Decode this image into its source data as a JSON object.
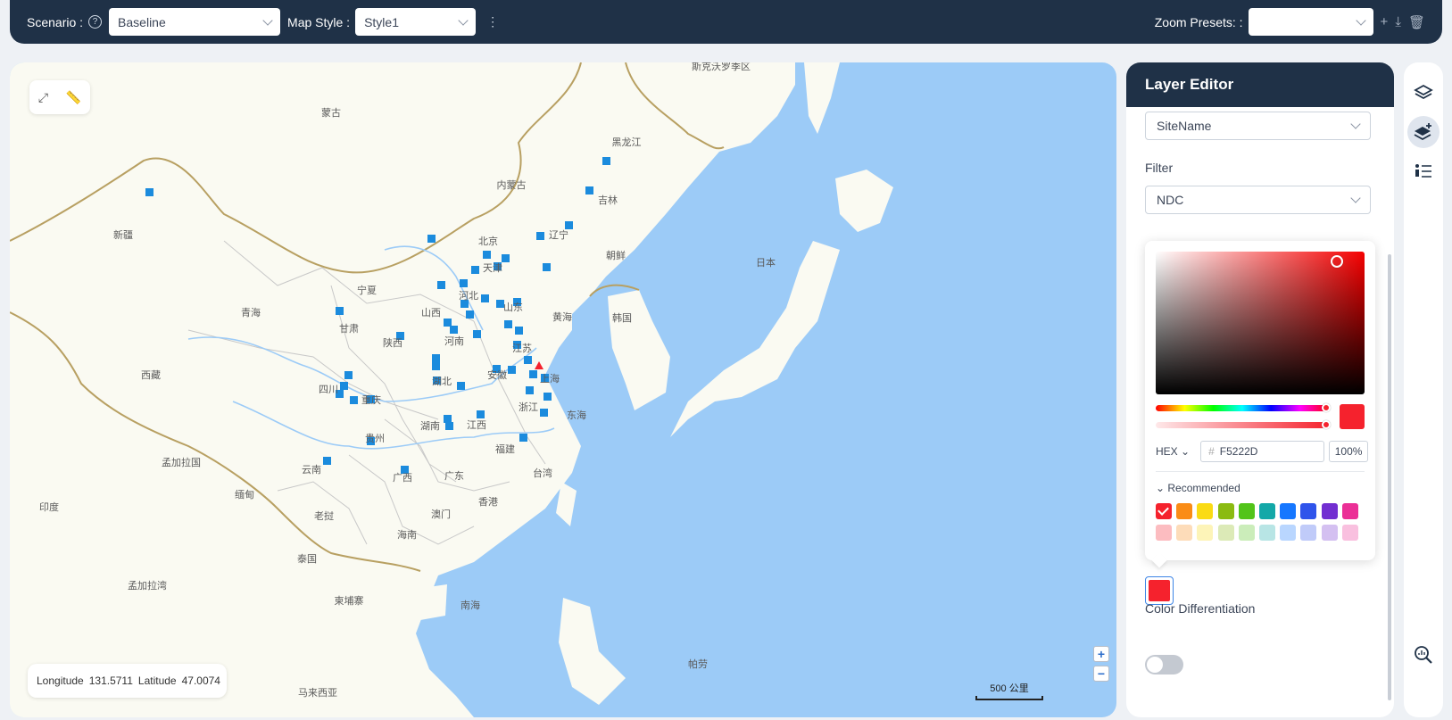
{
  "toolbar": {
    "scenario_label": "Scenario :",
    "scenario_value": "Baseline",
    "map_style_label": "Map Style :",
    "map_style_value": "Style1",
    "zoom_presets_label": "Zoom Presets: :",
    "zoom_presets_value": ""
  },
  "map": {
    "coords": {
      "lon_label": "Longitude",
      "lon": "131.5711",
      "lat_label": "Latitude",
      "lat": "47.0074"
    },
    "scale": "500 公里",
    "zoom_in": "+",
    "zoom_out": "−",
    "labels": [
      {
        "text": "斯克沃罗季区"
      },
      {
        "text": "蒙古"
      },
      {
        "text": "黑龙江"
      },
      {
        "text": "内蒙古"
      },
      {
        "text": "吉林"
      },
      {
        "text": "新疆"
      },
      {
        "text": "辽宁"
      },
      {
        "text": "北京"
      },
      {
        "text": "天津"
      },
      {
        "text": "朝鲜"
      },
      {
        "text": "日本"
      },
      {
        "text": "宁夏"
      },
      {
        "text": "河北"
      },
      {
        "text": "山西"
      },
      {
        "text": "山东"
      },
      {
        "text": "青海"
      },
      {
        "text": "黄海"
      },
      {
        "text": "韩国"
      },
      {
        "text": "甘肃"
      },
      {
        "text": "陕西"
      },
      {
        "text": "河南"
      },
      {
        "text": "江苏"
      },
      {
        "text": "西藏"
      },
      {
        "text": "四川"
      },
      {
        "text": "湖北"
      },
      {
        "text": "安徽"
      },
      {
        "text": "上海"
      },
      {
        "text": "重庆"
      },
      {
        "text": "浙江"
      },
      {
        "text": "东海"
      },
      {
        "text": "湖南"
      },
      {
        "text": "江西"
      },
      {
        "text": "贵州"
      },
      {
        "text": "福建"
      },
      {
        "text": "孟加拉国"
      },
      {
        "text": "云南"
      },
      {
        "text": "广西"
      },
      {
        "text": "广东"
      },
      {
        "text": "台湾"
      },
      {
        "text": "缅甸"
      },
      {
        "text": "香港"
      },
      {
        "text": "澳门"
      },
      {
        "text": "印度"
      },
      {
        "text": "老挝"
      },
      {
        "text": "海南"
      },
      {
        "text": "泰国"
      },
      {
        "text": "孟加拉湾"
      },
      {
        "text": "柬埔寨"
      },
      {
        "text": "南海"
      },
      {
        "text": "帕劳"
      },
      {
        "text": "马来西亚"
      }
    ]
  },
  "panel": {
    "title": "Layer Editor",
    "field_value": "SiteName",
    "filter_label": "Filter",
    "filter_value": "NDC",
    "color_hex_prefix": "#",
    "color_hex": "F5222D",
    "color_mode": "HEX",
    "alpha": "100%",
    "recommended_label": "Recommended",
    "swatches": [
      "#f5222d",
      "#fa8c16",
      "#fadb14",
      "#8bbb11",
      "#52c41a",
      "#13a8a8",
      "#1677ff",
      "#2f54eb",
      "#722ed1",
      "#eb2f96"
    ],
    "selected_color": "#f5222d",
    "color_differentiation_label": "Color Differentiation",
    "color_differentiation_on": false
  },
  "rail": {
    "icons": [
      "layers-icon",
      "layer-add-icon",
      "legend-list-icon",
      "data-search-icon"
    ]
  }
}
